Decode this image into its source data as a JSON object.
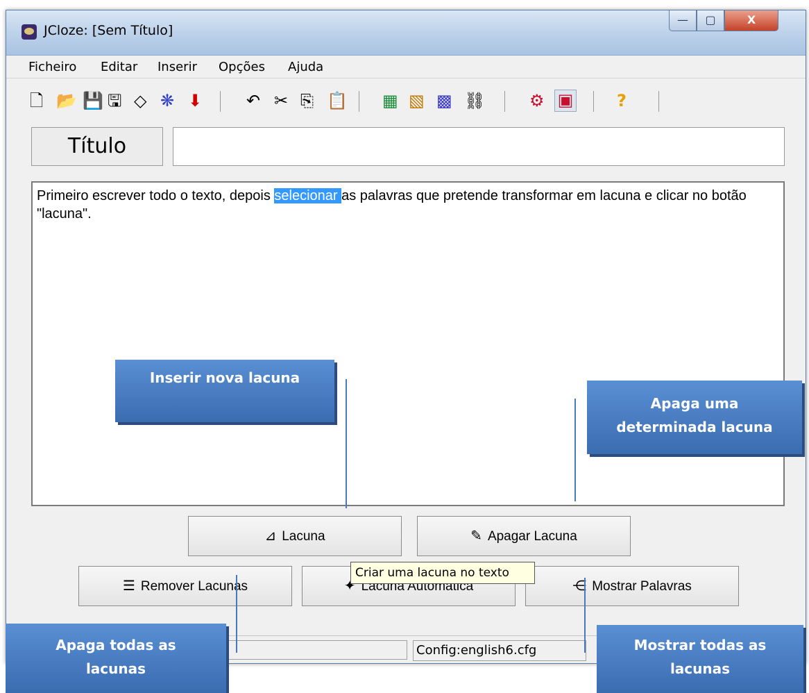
{
  "window": {
    "title": "JCloze: [Sem Título]",
    "min_label": "—",
    "max_label": "▢",
    "close_label": "X"
  },
  "menu": [
    "Ficheiro",
    "Editar",
    "Inserir",
    "Opções",
    "Ajuda"
  ],
  "toolbar_icons": [
    "new-file-icon",
    "open-folder-icon",
    "save-icon",
    "save-as-icon",
    "eraser-icon",
    "web-export-icon",
    "download-icon",
    "undo-icon",
    "cut-icon",
    "copy-icon",
    "paste-icon",
    "export-hotpot-icon",
    "image-icon",
    "web-page-icon",
    "link-icon",
    "config-icon",
    "display-toggle-icon",
    "help-icon"
  ],
  "title_field": {
    "label": "Título",
    "value": ""
  },
  "editor": {
    "before": "Primeiro escrever todo o texto, depois ",
    "selected": "selecionar ",
    "after": "as palavras que pretende transformar em lacuna e clicar no botão \"lacuna\"."
  },
  "buttons": {
    "lacuna": "Lacuna",
    "apagar": "Apagar Lacuna",
    "remover": "Remover Lacunas",
    "automatica": "Lacuna Automática",
    "mostrar": "Mostrar Palavras"
  },
  "tooltip": "Criar uma lacuna no texto",
  "status": {
    "config": "Config:english6.cfg"
  },
  "callouts": {
    "inserir": "Inserir nova lacuna",
    "apaga_uma_1": "Apaga uma",
    "apaga_uma_2": "determinada lacuna",
    "apaga_todas_1": "Apaga todas as",
    "apaga_todas_2": "lacunas",
    "mostrar_1": "Mostrar todas as",
    "mostrar_2": "lacunas"
  },
  "colors": {
    "selection": "#3399ff",
    "callout": "#4a7fc4",
    "tooltip_bg": "#ffffe1"
  }
}
